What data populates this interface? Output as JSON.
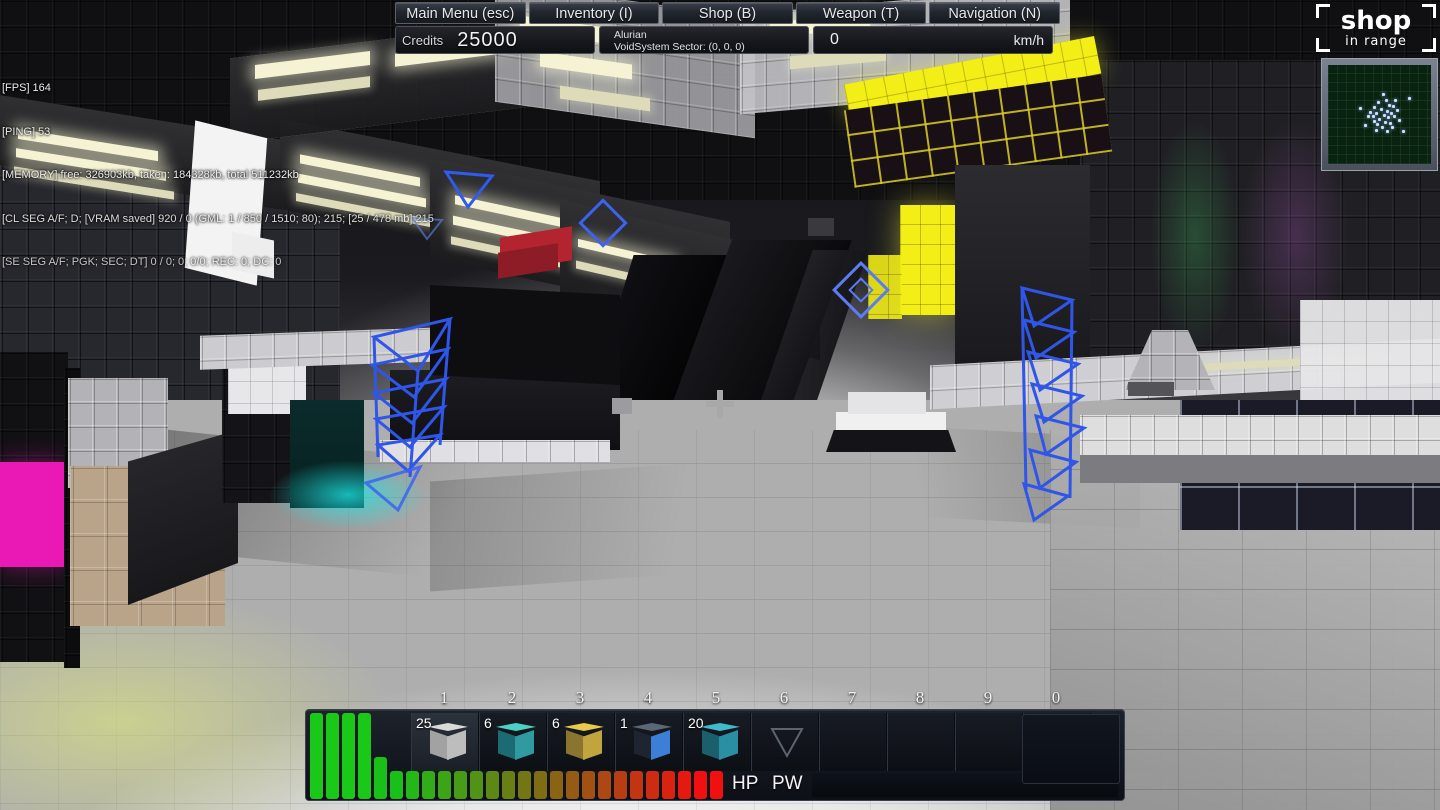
{
  "debug": {
    "lines": [
      "[FPS] 164",
      "[PING] 53",
      "[MEMORY] free: 326903kb, taken: 184328kb, total 511232kb",
      "[CL SEG A/F; D; [VRAM saved] 920 / 0 (GML: 1 / 850 / 1510; 80); 215; [25 / 478 mb] 215",
      "[SE SEG A/F; PGK; SEC; DT] 0 / 0; 0; 0/0; REC: 0; DC: 0"
    ]
  },
  "topbar": {
    "tabs": [
      {
        "label": "Main Menu (esc)",
        "name": "tab-main-menu"
      },
      {
        "label": "Inventory (I)",
        "name": "tab-inventory"
      },
      {
        "label": "Shop (B)",
        "name": "tab-shop"
      },
      {
        "label": "Weapon (T)",
        "name": "tab-weapon"
      },
      {
        "label": "Navigation (N)",
        "name": "tab-navigation"
      }
    ],
    "credits_label": "Credits",
    "credits_value": "25000",
    "sector_name": "Alurian",
    "sector_coords": "VoidSystem Sector: (0, 0, 0)",
    "speed_value": "0",
    "speed_unit": "km/h"
  },
  "shop_indicator": {
    "title": "shop",
    "subtitle": "in range"
  },
  "radar": {
    "blips": [
      [
        52,
        28
      ],
      [
        55,
        34
      ],
      [
        48,
        36
      ],
      [
        58,
        39
      ],
      [
        44,
        41
      ],
      [
        62,
        40
      ],
      [
        50,
        43
      ],
      [
        56,
        45
      ],
      [
        46,
        47
      ],
      [
        60,
        47
      ],
      [
        53,
        49
      ],
      [
        43,
        51
      ],
      [
        57,
        52
      ],
      [
        49,
        54
      ],
      [
        63,
        50
      ],
      [
        40,
        46
      ],
      [
        66,
        44
      ],
      [
        54,
        57
      ],
      [
        47,
        59
      ],
      [
        59,
        58
      ],
      [
        51,
        62
      ],
      [
        44,
        56
      ],
      [
        61,
        62
      ],
      [
        38,
        50
      ],
      [
        68,
        55
      ],
      [
        56,
        66
      ],
      [
        46,
        65
      ],
      [
        30,
        42
      ],
      [
        78,
        32
      ],
      [
        72,
        66
      ],
      [
        35,
        60
      ],
      [
        64,
        34
      ]
    ]
  },
  "hotbar": {
    "slots": [
      {
        "key": "1",
        "count": "25",
        "icon": "rock-block-icon",
        "selected": true,
        "top": "#d9d9d9",
        "left": "#a2a2a2",
        "right": "#bdbdbd"
      },
      {
        "key": "2",
        "count": "6",
        "icon": "power-block-icon",
        "selected": false,
        "top": "#4fd0c6",
        "left": "#1d6b72",
        "right": "#2f9aa0"
      },
      {
        "key": "3",
        "count": "6",
        "icon": "gold-hull-icon",
        "selected": false,
        "top": "#e8c94a",
        "left": "#8a7530",
        "right": "#c2a43f"
      },
      {
        "key": "4",
        "count": "1",
        "icon": "display-block-icon",
        "selected": false,
        "top": "#5b6676",
        "left": "#1e2530",
        "right": "#3d7fd6"
      },
      {
        "key": "5",
        "count": "20",
        "icon": "shield-block-icon",
        "selected": false,
        "top": "#3fb9cc",
        "left": "#1b5f6d",
        "right": "#2a8fa3"
      },
      {
        "key": "6",
        "count": "",
        "icon": "triangle-empty-icon",
        "selected": false
      },
      {
        "key": "7",
        "count": "",
        "icon": "",
        "selected": false
      },
      {
        "key": "8",
        "count": "",
        "icon": "",
        "selected": false
      },
      {
        "key": "9",
        "count": "",
        "icon": "",
        "selected": false
      },
      {
        "key": "0",
        "count": "",
        "icon": "",
        "selected": false
      }
    ],
    "hp_label": "HP",
    "pw_label": "PW"
  },
  "colors": {
    "accent_blue": "#3355ee",
    "waypoint_blue": "#3a5fe8",
    "light_yellow": "#f5f3d4",
    "hull_yellow": "#f3ee16",
    "magenta": "#f318b5",
    "cyan": "#20e0e0",
    "radar_green": "#0a2210",
    "hp_green": "#19c019",
    "hp_red": "#f01010"
  },
  "crosshair": {
    "name": "crosshair"
  }
}
